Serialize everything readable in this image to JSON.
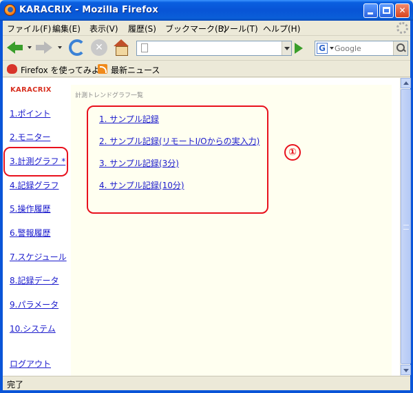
{
  "window": {
    "title": "KARACRIX - Mozilla Firefox"
  },
  "menu": {
    "file": "ファイル(F)",
    "edit": "編集(E)",
    "view": "表示(V)",
    "history": "履歴(S)",
    "bookmarks": "ブックマーク(B)",
    "tools": "ツール(T)",
    "help": "ヘルプ(H)"
  },
  "toolbar": {
    "url_value": "",
    "search_placeholder": "Google"
  },
  "bookmarks": {
    "getting_started": "Firefox を使ってみよう",
    "latest_news": "最新ニュース"
  },
  "sidebar": {
    "brand": "KARACRIX",
    "items": [
      "1.ポイント",
      "2.モニター",
      "3.計測グラフ *",
      "4.記録グラフ",
      "5.操作履歴",
      "6.警報履歴",
      "7.スケジュール",
      "8.記録データ",
      "9.パラメータ",
      "10.システム"
    ],
    "logout": "ログアウト"
  },
  "main": {
    "heading": "計測トレンドグラフ一覧",
    "links": [
      "1. サンプル記録",
      "2. サンプル記録(リモートI/Oからの実入力)",
      "3. サンプル記録(3分)",
      "4. サンプル記録(10分)"
    ]
  },
  "annotation": {
    "number": "①"
  },
  "status": {
    "text": "完了"
  },
  "colors": {
    "titlebar": "#0854d6",
    "link": "#1a1acc",
    "brand": "#d83020",
    "annotation": "#e8101c",
    "main_bg": "#fffff0"
  }
}
